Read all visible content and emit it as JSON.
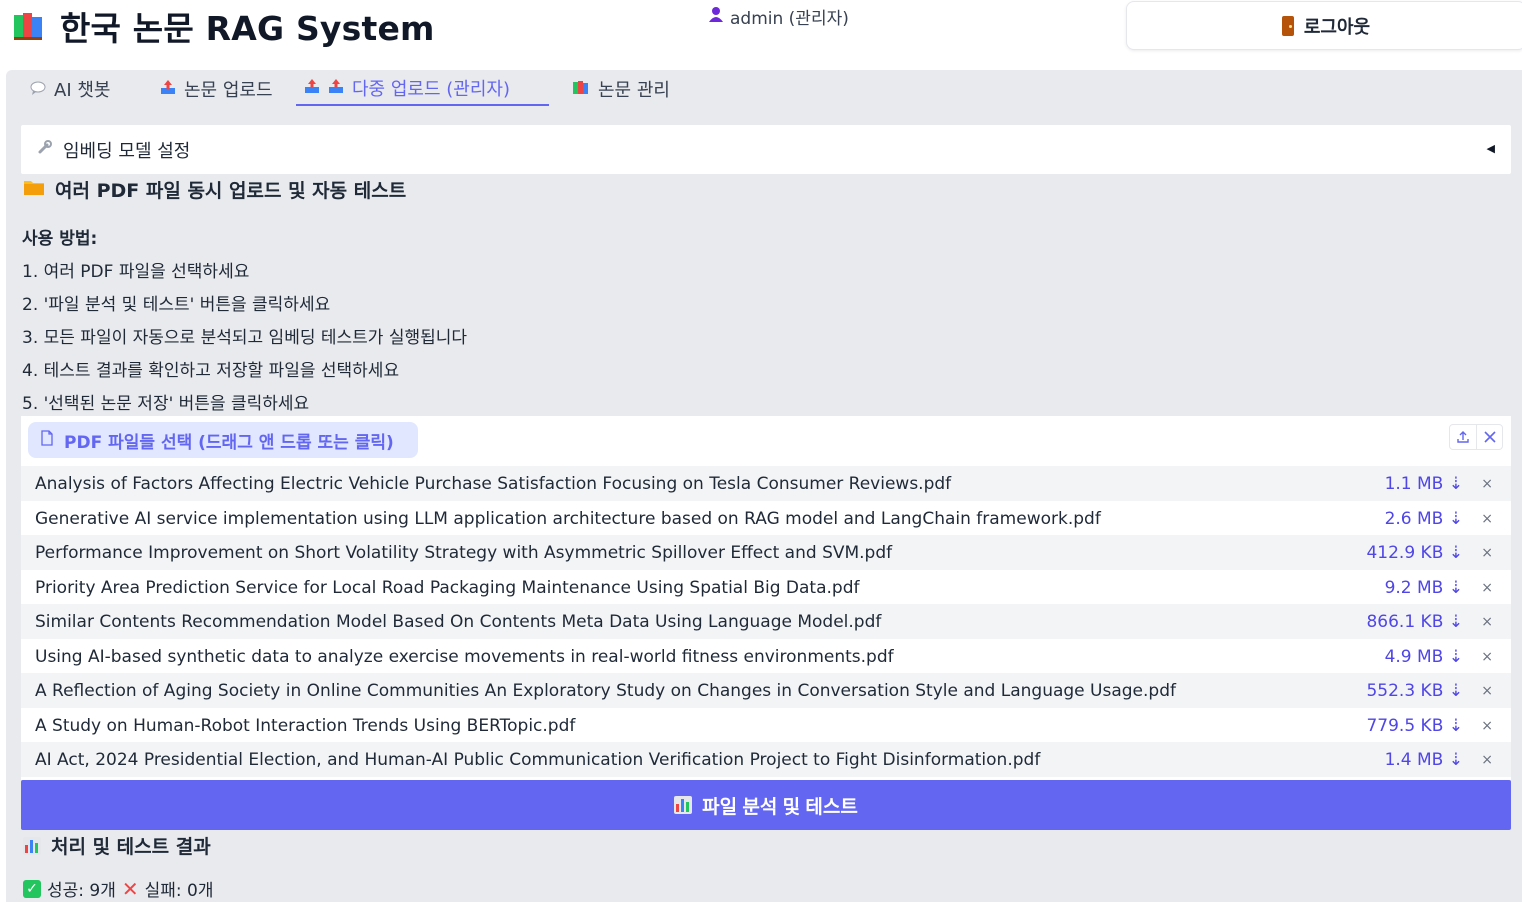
{
  "header": {
    "title": "한국 논문 RAG System",
    "user": "admin (관리자)",
    "logout_label": "로그아웃"
  },
  "tabs": [
    {
      "label": "AI 챗봇",
      "active": false
    },
    {
      "label": "논문 업로드",
      "active": false
    },
    {
      "label": "다중 업로드 (관리자)",
      "active": true
    },
    {
      "label": "논문 관리",
      "active": false
    }
  ],
  "expander": {
    "label": "임베딩 모델 설정",
    "arrow": "◀"
  },
  "section": {
    "title": "여러 PDF 파일 동시 업로드 및 자동 테스트"
  },
  "usage": {
    "heading": "사용 방법:",
    "steps": [
      "1. 여러 PDF 파일을 선택하세요",
      "2. '파일 분석 및 테스트' 버튼을 클릭하세요",
      "3. 모든 파일이 자동으로 분석되고 임베딩 테스트가 실행됩니다",
      "4. 테스트 결과를 확인하고 저장할 파일을 선택하세요",
      "5. '선택된 논문 저장' 버튼을 클릭하세요"
    ]
  },
  "uploader": {
    "label": "PDF 파일들 선택 (드래그 앤 드롭 또는 클릭)",
    "files": [
      {
        "name": "Analysis of Factors Affecting Electric Vehicle Purchase Satisfaction Focusing on Tesla Consumer Reviews.pdf",
        "size": "1.1 MB ⇣"
      },
      {
        "name": "Generative AI service implementation using LLM application architecture based on RAG model and LangChain framework.pdf",
        "size": "2.6 MB ⇣"
      },
      {
        "name": "Performance Improvement on Short Volatility Strategy with Asymmetric Spillover Effect and SVM.pdf",
        "size": "412.9 KB ⇣"
      },
      {
        "name": "Priority Area Prediction Service for Local Road Packaging Maintenance Using Spatial Big Data.pdf",
        "size": "9.2 MB ⇣"
      },
      {
        "name": "Similar Contents Recommendation Model Based On Contents Meta Data Using Language Model.pdf",
        "size": "866.1 KB ⇣"
      },
      {
        "name": "Using AI-based synthetic data to analyze exercise movements in real-world fitness environments.pdf",
        "size": "4.9 MB ⇣"
      },
      {
        "name": "A Reflection of Aging Society in Online Communities An Exploratory Study on Changes in Conversation Style and Language Usage.pdf",
        "size": "552.3 KB ⇣"
      },
      {
        "name": "A Study on Human-Robot Interaction Trends Using BERTopic.pdf",
        "size": "779.5 KB ⇣"
      },
      {
        "name": "AI Act, 2024 Presidential Election, and Human-AI Public Communication Verification Project to Fight Disinformation.pdf",
        "size": "1.4 MB ⇣"
      }
    ],
    "remove_glyph": "×"
  },
  "analyze_button": {
    "label": "파일 분석 및 테스트"
  },
  "results": {
    "title": "처리 및 테스트 결과",
    "success": "성공: 9개",
    "fail": "실패: 0개"
  },
  "colors": {
    "accent": "#6366f1",
    "background": "#e9eaee"
  }
}
